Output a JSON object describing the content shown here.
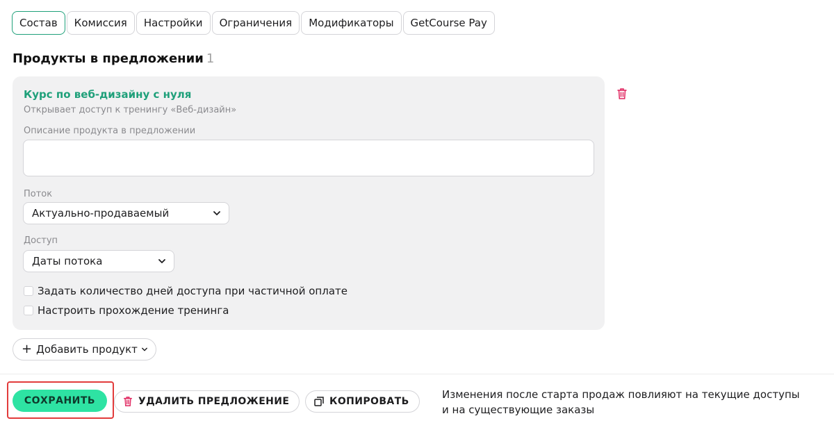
{
  "tabs": [
    {
      "label": "Состав",
      "active": true
    },
    {
      "label": "Комиссия"
    },
    {
      "label": "Настройки"
    },
    {
      "label": "Ограничения"
    },
    {
      "label": "Модификаторы"
    },
    {
      "label": "GetCourse Pay"
    }
  ],
  "section": {
    "title": "Продукты в предложении",
    "count": "1"
  },
  "product": {
    "name": "Курс по веб-дизайну с нуля",
    "subtitle": "Открывает доступ к тренингу «Веб-дизайн»",
    "description_label": "Описание продукта в предложении",
    "description_value": "",
    "stream_label": "Поток",
    "stream_value": "Актуально-продаваемый",
    "access_label": "Доступ",
    "access_value": "Даты потока",
    "checkbox_days": "Задать количество дней доступа при частичной оплате",
    "checkbox_training": "Настроить прохождение тренинга"
  },
  "add_product": {
    "label": "Добавить продукт",
    "icon": "plus-icon"
  },
  "footer": {
    "save_label": "СОХРАНИТЬ",
    "delete_label": "УДАЛИТЬ ПРЕДЛОЖЕНИЕ",
    "copy_label": "КОПИРОВАТЬ",
    "note_line1": "Изменения после старта продаж повлияют на текущие доступы",
    "note_line2": "и на существующие заказы"
  },
  "colors": {
    "accent": "#1fa07a",
    "save_bg": "#2ee3a3",
    "danger": "#e0245e",
    "highlight": "#e23b3b"
  }
}
